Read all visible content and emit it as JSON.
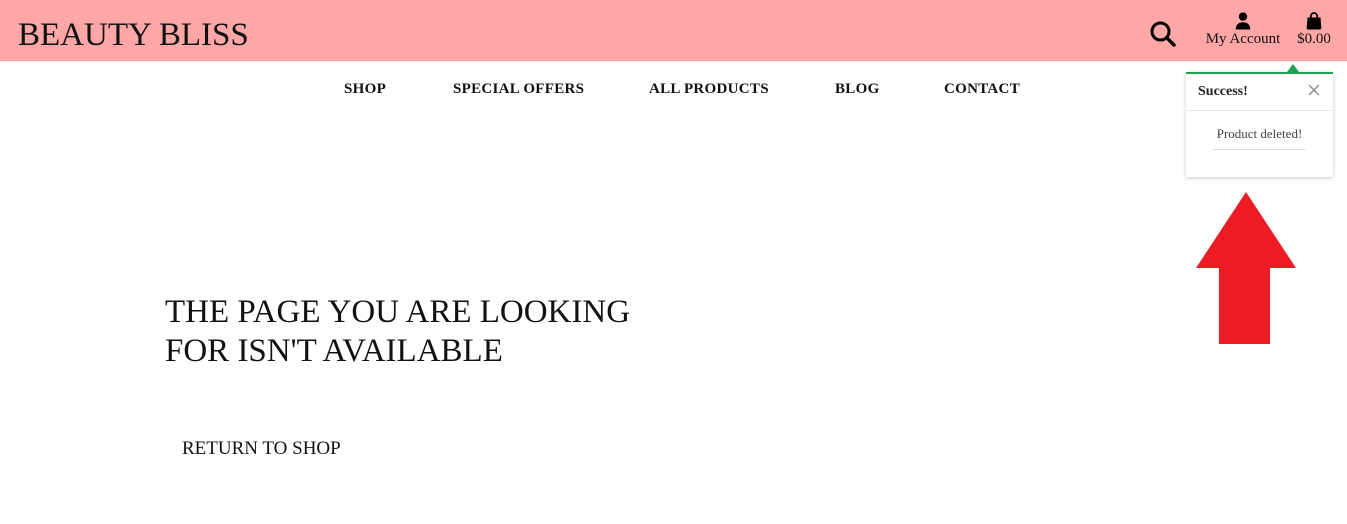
{
  "header": {
    "brand": "BEAUTY BLISS",
    "search_icon": "search-icon",
    "account_label": "My Account",
    "account_icon": "user-icon",
    "bag_total": "$0.00",
    "bag_icon": "shopping-bag-icon",
    "background_color": "#ffa6a6"
  },
  "nav": {
    "items": [
      {
        "label": "SHOP"
      },
      {
        "label": "SPECIAL OFFERS"
      },
      {
        "label": "ALL PRODUCTS"
      },
      {
        "label": "BLOG"
      },
      {
        "label": "CONTACT"
      }
    ]
  },
  "toast": {
    "title": "Success!",
    "message": "Product deleted!",
    "close_icon": "close-icon",
    "accent_color": "#1ea24e"
  },
  "annotation": {
    "arrow_icon": "up-arrow-icon",
    "color": "#ed1c24"
  },
  "main": {
    "heading_line1": "THE PAGE YOU ARE LOOKING",
    "heading_line2": "FOR ISN'T AVAILABLE",
    "return_label": "RETURN TO SHOP"
  }
}
